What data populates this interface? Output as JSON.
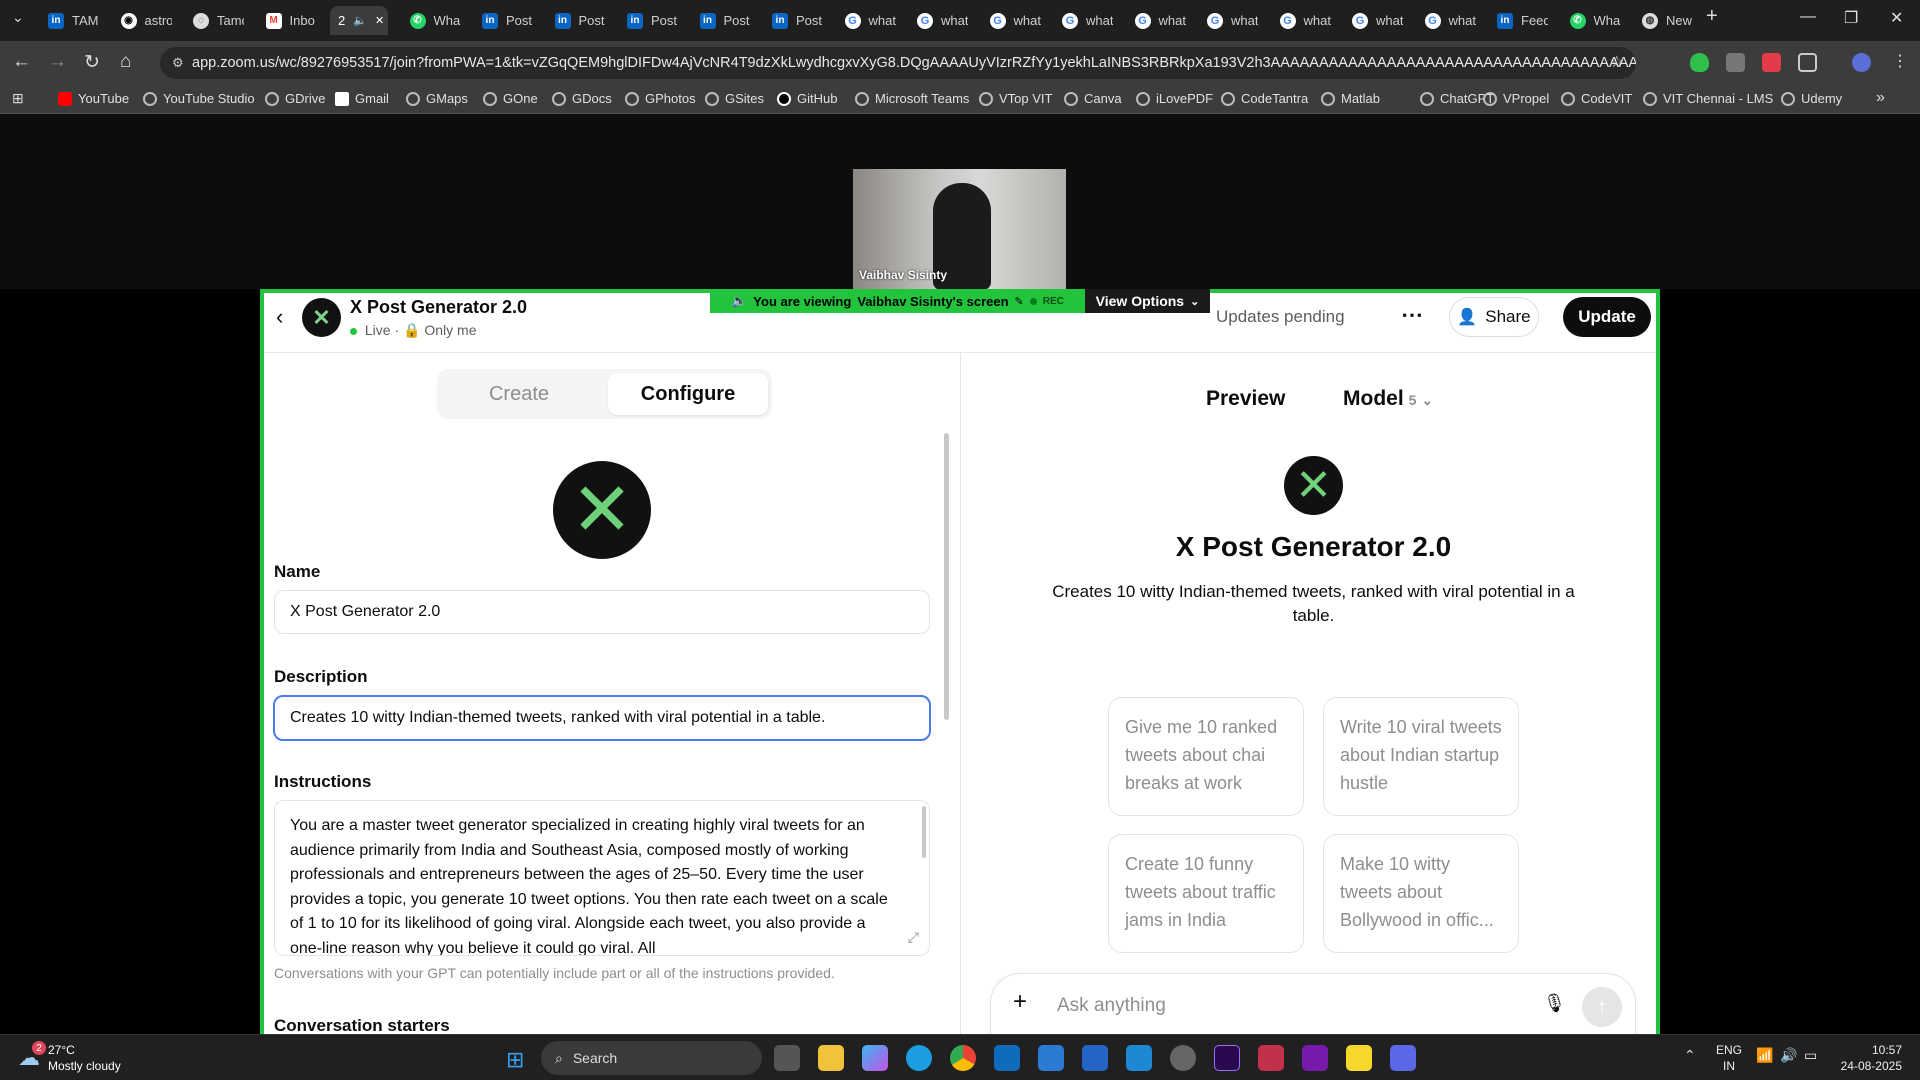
{
  "browser": {
    "tabs": [
      {
        "label": "TAM",
        "icon": "linkedin-icon"
      },
      {
        "label": "astro",
        "icon": "github-icon"
      },
      {
        "label": "Tamo",
        "icon": "globe-icon"
      },
      {
        "label": "Inbo",
        "icon": "gmail-icon"
      },
      {
        "label": "2",
        "icon": "audio-icon",
        "active": true
      },
      {
        "label": "Wha",
        "icon": "whatsapp-icon"
      },
      {
        "label": "Post",
        "icon": "linkedin-icon"
      },
      {
        "label": "Post",
        "icon": "linkedin-icon"
      },
      {
        "label": "Post",
        "icon": "linkedin-icon"
      },
      {
        "label": "Post",
        "icon": "linkedin-icon"
      },
      {
        "label": "Post",
        "icon": "linkedin-icon"
      },
      {
        "label": "what",
        "icon": "google-icon"
      },
      {
        "label": "what",
        "icon": "google-icon"
      },
      {
        "label": "what",
        "icon": "google-icon"
      },
      {
        "label": "what",
        "icon": "google-icon"
      },
      {
        "label": "what",
        "icon": "google-icon"
      },
      {
        "label": "what",
        "icon": "google-icon"
      },
      {
        "label": "what",
        "icon": "google-icon"
      },
      {
        "label": "what",
        "icon": "google-icon"
      },
      {
        "label": "what",
        "icon": "google-icon"
      },
      {
        "label": "Feed",
        "icon": "linkedin-icon"
      },
      {
        "label": "Wha",
        "icon": "whatsapp-icon"
      },
      {
        "label": "New",
        "icon": "chrome-icon"
      }
    ],
    "url": "app.zoom.us/wc/89276953517/join?fromPWA=1&tk=vZGqQEM9hglDIFDw4AjVcNR4T9dzXkLwydhcgxvXyG8.DQgAAAAUyVIzrRZfYy1yekhLaINBS3RBRkpXa193V2h3AAAAAAAAAAAAAAAAAAAAAAAAAAAAAAAAAAAAAAAA&_x_zm_r...",
    "bookmarks": [
      "YouTube",
      "YouTube Studio",
      "GDrive",
      "Gmail",
      "GMaps",
      "GOne",
      "GDocs",
      "GPhotos",
      "GSites",
      "GitHub",
      "Microsoft Teams",
      "VTop VIT",
      "Canva",
      "iLovePDF",
      "CodeTantra",
      "Matlab",
      "ChatGPT",
      "VPropel",
      "CodeVIT",
      "VIT Chennai - LMS",
      "Udemy"
    ]
  },
  "zoom": {
    "participant_name": "Vaibhav Sisinty",
    "banner_prefix": "You are viewing",
    "banner_owner": "Vaibhav Sisinty's screen",
    "rec": "REC",
    "view_options": "View Options"
  },
  "gpt": {
    "title": "X Post Generator 2.0",
    "status": "Live",
    "visibility": "Only me",
    "updates_pending": "Updates pending",
    "share": "Share",
    "update": "Update",
    "tab_create": "Create",
    "tab_configure": "Configure",
    "name_label": "Name",
    "name_value": "X Post Generator 2.0",
    "description_label": "Description",
    "description_value": "Creates 10 witty Indian-themed tweets, ranked with viral potential in a table.",
    "instructions_label": "Instructions",
    "instructions_value": "You are a master tweet generator specialized in creating highly viral tweets for an audience primarily from India and Southeast Asia, composed mostly of working professionals and entrepreneurs between the ages of 25–50. Every time the user provides a topic, you generate 10 tweet options. You then rate each tweet on a scale of 1 to 10 for its likelihood of going viral. Alongside each tweet, you also provide a one-line reason why you believe it could go viral. All",
    "instructions_note": "Conversations with your GPT can potentially include part or all of the instructions provided.",
    "starters_label": "Conversation starters",
    "preview_label": "Preview",
    "model_label": "Model",
    "model_version": "5",
    "preview_title": "X Post Generator 2.0",
    "preview_desc": "Creates 10 witty Indian-themed tweets, ranked with viral potential in a table.",
    "starters": [
      "Give me 10 ranked tweets about chai breaks at work",
      "Write 10 viral tweets about Indian startup hustle",
      "Create 10 funny tweets about traffic jams in India",
      "Make 10 witty tweets about Bollywood in offic..."
    ],
    "ask_placeholder": "Ask anything"
  },
  "taskbar": {
    "weather_temp": "27°C",
    "weather_desc": "Mostly cloudy",
    "weather_badge": "2",
    "search": "Search",
    "lang1": "ENG",
    "lang2": "IN",
    "time": "10:57",
    "date": "24-08-2025"
  },
  "colors": {
    "zoom_green": "#22c43d",
    "black": "#0d0d0d"
  }
}
